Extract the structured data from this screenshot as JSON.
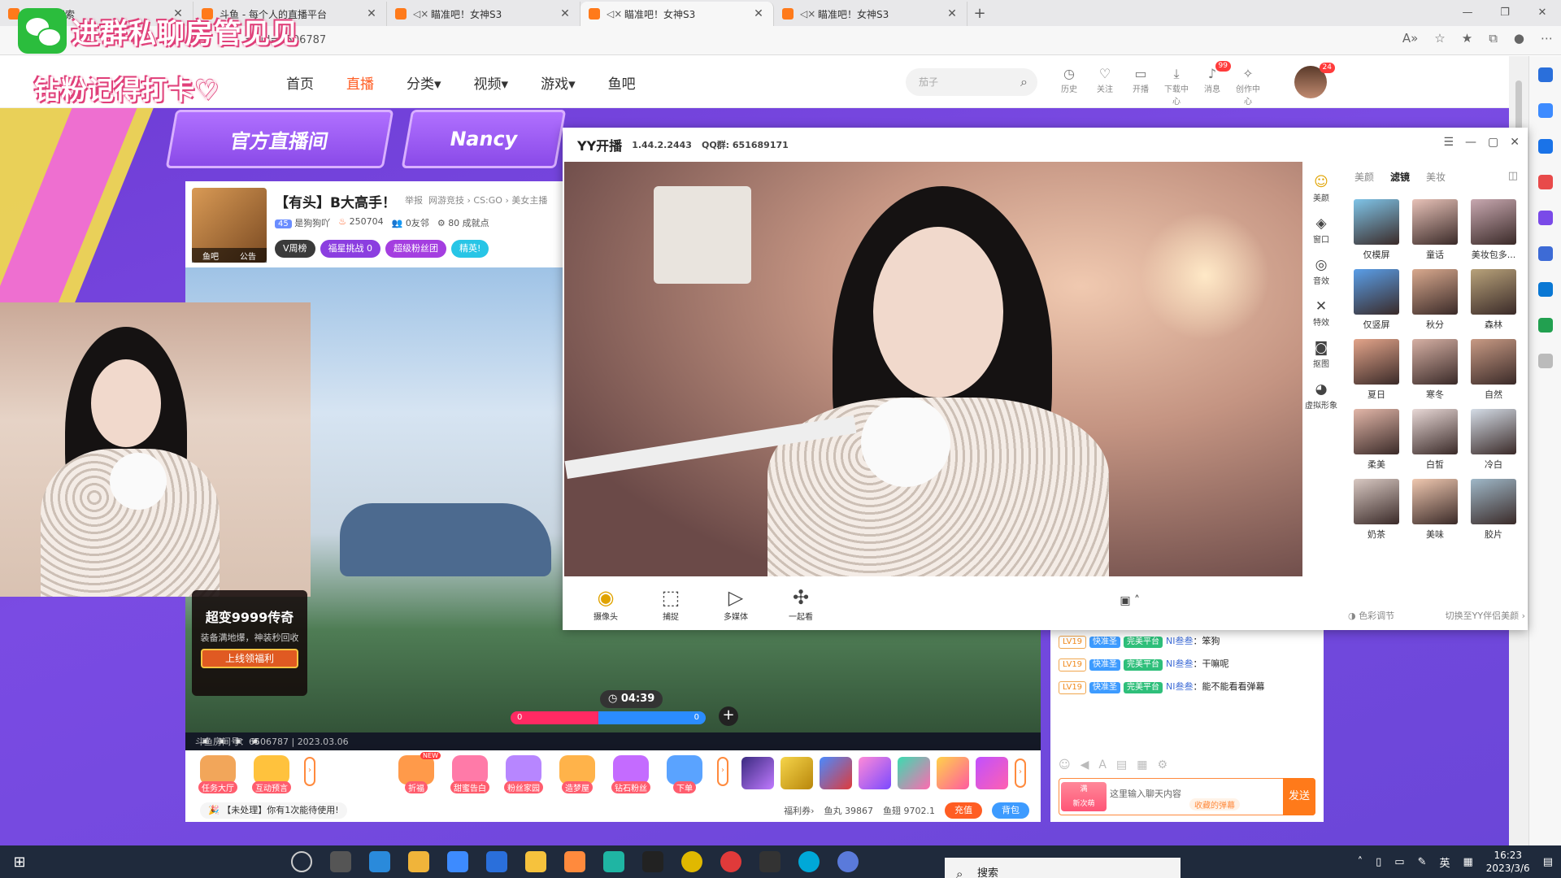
{
  "browser": {
    "tabs": [
      {
        "title": "斗鱼 - 搜索",
        "muted": false
      },
      {
        "title": "斗鱼 - 每个人的直播平台",
        "muted": false
      },
      {
        "title": "瞄准吧！女神S3",
        "muted": true
      },
      {
        "title": "瞄准吧！女神S3",
        "muted": true
      },
      {
        "title": "瞄准吧！女神S3",
        "muted": true
      }
    ],
    "url": "3?rid=6506787"
  },
  "overlay": {
    "line1": "进群私聊房管见见",
    "line2": "钻粉记得打卡"
  },
  "site": {
    "nav": [
      "首页",
      "直播",
      "分类",
      "视频",
      "游戏",
      "鱼吧"
    ],
    "active_nav": "直播",
    "search_placeholder": "茄子",
    "header_icons": [
      {
        "label": "历史",
        "icon": "clock-icon",
        "glyph": "◷"
      },
      {
        "label": "关注",
        "icon": "heart-icon",
        "glyph": "♡"
      },
      {
        "label": "开播",
        "icon": "broadcast-icon",
        "glyph": "▭"
      },
      {
        "label": "下载中心",
        "icon": "download-icon",
        "glyph": "⤓"
      },
      {
        "label": "消息",
        "icon": "bell-icon",
        "glyph": "♪",
        "badge": "99"
      },
      {
        "label": "创作中心",
        "icon": "bulb-icon",
        "glyph": "✧"
      }
    ],
    "avatar_badge": "24"
  },
  "banners": [
    "官方直播间",
    "Nancy"
  ],
  "streamer": {
    "title": "【有头】B大高手！",
    "report": "举报",
    "categories": "网游竞技 › CS:GO › 美女主播",
    "level": "45",
    "name": "是狗狗吖",
    "hot": "250704",
    "friends": "0友邻",
    "achievements": "80 成就点",
    "thumb_left": "鱼吧",
    "thumb_right": "公告",
    "pills": [
      "V周榜",
      "福星挑战 0",
      "超级粉丝团",
      "精英!"
    ]
  },
  "video": {
    "ad_title": "超变9999传奇",
    "ad_desc": "装备满地爆，神装秒回收",
    "ad_button": "上线领福利",
    "pk_time": "04:39",
    "pk_left": "0",
    "pk_right": "0",
    "room_id": "斗鱼房间号：6506787 | 2023.03.06"
  },
  "gifts": {
    "left": [
      {
        "label": "任务大厅",
        "color": "#f2a65a"
      },
      {
        "label": "互动预言",
        "color": "#ffc23d"
      }
    ],
    "mid": [
      {
        "label": "折福",
        "color": "#ff9a4a",
        "new": "NEW"
      },
      {
        "label": "甜蜜告白",
        "color": "#ff7aa8"
      },
      {
        "label": "粉丝家园",
        "color": "#b786ff"
      },
      {
        "label": "造梦屋",
        "color": "#ffb34a"
      },
      {
        "label": "钻石粉丝",
        "color": "#c46bff"
      },
      {
        "label": "下单",
        "color": "#5aa3ff"
      }
    ],
    "notice": "【未处理】你有1次能待使用!",
    "welfare": "福利券›",
    "fishball": "鱼丸 39867",
    "fishfin": "鱼翅 9702.1",
    "recharge": "充值",
    "backpack": "背包"
  },
  "chat": {
    "messages": [
      {
        "level": "LV19",
        "tag1": "快准圣",
        "tag2": "完美平台",
        "user": "NI叁叁",
        "text": "笨狗"
      },
      {
        "level": "LV19",
        "tag1": "快准圣",
        "tag2": "完美平台",
        "user": "NI叁叁",
        "text": "干嘛呢"
      },
      {
        "level": "LV19",
        "tag1": "快准圣",
        "tag2": "完美平台",
        "user": "NI叁叁",
        "text": "能不能看看弹幕"
      }
    ],
    "input_placeholder": "这里输入聊天内容",
    "hint": "收藏的弹幕",
    "send": "发送",
    "badge_top": "满",
    "badge_bottom": "新次萌"
  },
  "yy": {
    "app": "YY开播",
    "version": "1.44.2.2443",
    "qq": "QQ群: 651689171",
    "tools": [
      {
        "label": "摄像头",
        "icon": "camera-icon",
        "glyph": "◉",
        "active": true
      },
      {
        "label": "捕捉",
        "icon": "capture-icon",
        "glyph": "⬚",
        "active": false
      },
      {
        "label": "多媒体",
        "icon": "media-icon",
        "glyph": "▷",
        "active": false
      },
      {
        "label": "一起看",
        "icon": "watch-together-icon",
        "glyph": "✣",
        "active": false
      }
    ],
    "side": [
      {
        "label": "美颜",
        "icon": "smile-icon",
        "glyph": "☺",
        "active": true
      },
      {
        "label": "窗口",
        "icon": "layers-icon",
        "glyph": "◈",
        "active": false
      },
      {
        "label": "音效",
        "icon": "sound-icon",
        "glyph": "◎",
        "active": false
      },
      {
        "label": "特效",
        "icon": "magic-icon",
        "glyph": "✕",
        "active": false
      },
      {
        "label": "抠图",
        "icon": "cutout-icon",
        "glyph": "◙",
        "active": false
      },
      {
        "label": "虚拟形象",
        "icon": "avatar-icon",
        "glyph": "◕",
        "active": false
      }
    ],
    "filter_tabs": [
      "美颜",
      "滤镜",
      "美妆"
    ],
    "active_filter_tab": "滤镜",
    "filters": [
      {
        "label": "仅模屏",
        "color": "#7fc4e8"
      },
      {
        "label": "童话",
        "color": "#e8c2b8"
      },
      {
        "label": "美妆包多...",
        "color": "#c8a8b0"
      },
      {
        "label": "仅竖屏",
        "color": "#5a9ee8"
      },
      {
        "label": "秋分",
        "color": "#d9a98e"
      },
      {
        "label": "森林",
        "color": "#b8a27a"
      },
      {
        "label": "夏日",
        "color": "#e3a48a"
      },
      {
        "label": "寒冬",
        "color": "#d6b0a4"
      },
      {
        "label": "自然",
        "color": "#c89a84"
      },
      {
        "label": "柔美",
        "color": "#e2b6a8"
      },
      {
        "label": "白皙",
        "color": "#e8d8d6"
      },
      {
        "label": "冷白",
        "color": "#d4dce6"
      },
      {
        "label": "奶茶",
        "color": "#d8c8c2"
      },
      {
        "label": "美味",
        "color": "#f0c8b0"
      },
      {
        "label": "胶片",
        "color": "#9fb8c8"
      }
    ],
    "footer_left": "色彩调节",
    "footer_right": "切换至YY伴侣美颜 ›"
  },
  "taskbar": {
    "search": "搜索",
    "ime": "英",
    "time": "16:23",
    "date": "2023/3/6"
  }
}
